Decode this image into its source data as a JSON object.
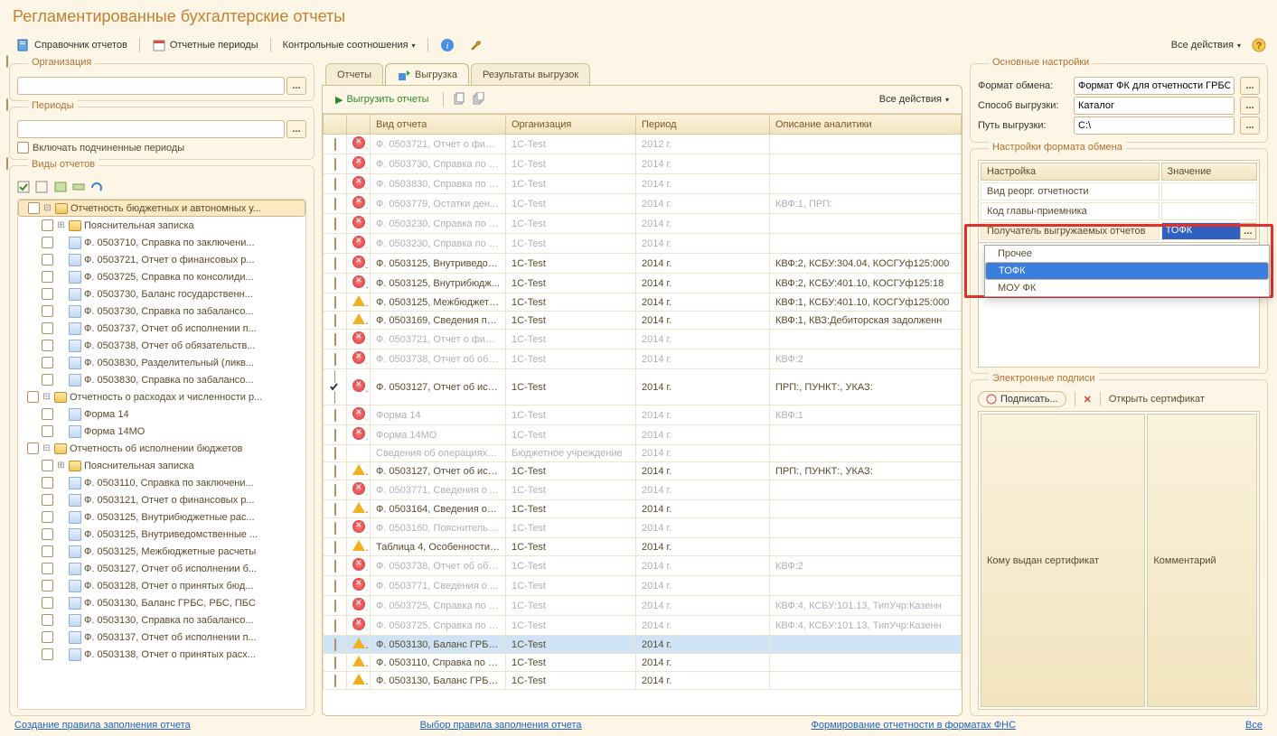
{
  "title": "Регламентированные бухгалтерские отчеты",
  "toolbar": {
    "ref_reports": "Справочник отчетов",
    "periods": "Отчетные периоды",
    "checks": "Контрольные соотношения",
    "all_actions": "Все действия"
  },
  "filters": {
    "org_legend": "Организация",
    "periods_legend": "Периоды",
    "include_sub": "Включать подчиненные периоды",
    "types_legend": "Виды отчетов"
  },
  "tree": [
    {
      "lvl": 0,
      "type": "folder",
      "exp": "minus",
      "sel": true,
      "label": "Отчетность бюджетных и автономных у..."
    },
    {
      "lvl": 1,
      "type": "folder",
      "exp": "plus",
      "label": "Пояснительная записка"
    },
    {
      "lvl": 1,
      "type": "doc",
      "label": "Ф. 0503710, Справка по заключени..."
    },
    {
      "lvl": 1,
      "type": "doc",
      "label": "Ф. 0503721, Отчет о финансовых р..."
    },
    {
      "lvl": 1,
      "type": "doc",
      "label": "Ф. 0503725, Справка по консолиди..."
    },
    {
      "lvl": 1,
      "type": "doc",
      "label": "Ф. 0503730, Баланс государственн..."
    },
    {
      "lvl": 1,
      "type": "doc",
      "label": "Ф. 0503730, Справка по забалансо..."
    },
    {
      "lvl": 1,
      "type": "doc",
      "label": "Ф. 0503737, Отчет об исполнении п..."
    },
    {
      "lvl": 1,
      "type": "doc",
      "label": "Ф. 0503738, Отчет об обязательств..."
    },
    {
      "lvl": 1,
      "type": "doc",
      "label": "Ф. 0503830, Разделительный (ликв..."
    },
    {
      "lvl": 1,
      "type": "doc",
      "label": "Ф. 0503830, Справка по забалансо..."
    },
    {
      "lvl": 0,
      "type": "folder",
      "exp": "minus",
      "label": "Отчетность о расходах и численности р..."
    },
    {
      "lvl": 1,
      "type": "doc",
      "label": "Форма 14"
    },
    {
      "lvl": 1,
      "type": "doc",
      "label": "Форма 14МО"
    },
    {
      "lvl": 0,
      "type": "folder",
      "exp": "minus",
      "label": "Отчетность об исполнении бюджетов"
    },
    {
      "lvl": 1,
      "type": "folder",
      "exp": "plus",
      "label": "Пояснительная записка"
    },
    {
      "lvl": 1,
      "type": "doc",
      "label": "Ф. 0503110, Справка по заключени..."
    },
    {
      "lvl": 1,
      "type": "doc",
      "label": "Ф. 0503121, Отчет о финансовых р..."
    },
    {
      "lvl": 1,
      "type": "doc",
      "label": "Ф. 0503125, Внутрибюджетные рас..."
    },
    {
      "lvl": 1,
      "type": "doc",
      "label": "Ф. 0503125, Внутриведомственные ..."
    },
    {
      "lvl": 1,
      "type": "doc",
      "label": "Ф. 0503125, Межбюджетные расчеты"
    },
    {
      "lvl": 1,
      "type": "doc",
      "label": "Ф. 0503127, Отчет об исполнении б..."
    },
    {
      "lvl": 1,
      "type": "doc",
      "label": "Ф. 0503128, Отчет о принятых бюд..."
    },
    {
      "lvl": 1,
      "type": "doc",
      "label": "Ф. 0503130, Баланс ГРБС, РБС, ПБС"
    },
    {
      "lvl": 1,
      "type": "doc",
      "label": "Ф. 0503130, Справка по забалансо..."
    },
    {
      "lvl": 1,
      "type": "doc",
      "label": "Ф. 0503137, Отчет об исполнении п..."
    },
    {
      "lvl": 1,
      "type": "doc",
      "label": "Ф. 0503138, Отчет о принятых расх..."
    }
  ],
  "tabs": {
    "reports": "Отчеты",
    "export": "Выгрузка",
    "results": "Результаты выгрузок"
  },
  "export_toolbar": {
    "export_reports": "Выгрузить отчеты",
    "all_actions": "Все действия"
  },
  "grid": {
    "headers": {
      "report": "Вид отчета",
      "org": "Организация",
      "period": "Период",
      "analytics": "Описание аналитики"
    },
    "rows": [
      {
        "dim": true,
        "st": "err",
        "rep": "Ф. 0503721, Отчет о фина...",
        "org": "1C-Test",
        "per": "2012 г.",
        "an": ""
      },
      {
        "dim": true,
        "st": "err",
        "rep": "Ф. 0503730, Справка по з...",
        "org": "1C-Test",
        "per": "2014 г.",
        "an": ""
      },
      {
        "dim": true,
        "st": "err",
        "rep": "Ф. 0503830, Справка по з...",
        "org": "1C-Test",
        "per": "2014 г.",
        "an": ""
      },
      {
        "dim": true,
        "st": "err",
        "rep": "Ф. 0503779, Остатки ден...",
        "org": "1C-Test",
        "per": "2014 г.",
        "an": "КВФ:1, ПРП:"
      },
      {
        "dim": true,
        "st": "err",
        "rep": "Ф. 0503230, Справка по з...",
        "org": "1C-Test",
        "per": "2014 г.",
        "an": ""
      },
      {
        "dim": true,
        "st": "err",
        "rep": "Ф. 0503230, Справка по з...",
        "org": "1C-Test",
        "per": "2014 г.",
        "an": ""
      },
      {
        "dim": false,
        "st": "err",
        "rep": "Ф. 0503125, Внутриведом...",
        "org": "1C-Test",
        "per": "2014 г.",
        "an": "КВФ:2, КСБУ:304.04, КОСГУф125:000"
      },
      {
        "dim": false,
        "st": "err",
        "rep": "Ф. 0503125, Внутрибюдж...",
        "org": "1C-Test",
        "per": "2014 г.",
        "an": "КВФ:2, КСБУ:401.10, КОСГУф125:18"
      },
      {
        "dim": false,
        "st": "warn",
        "rep": "Ф. 0503125, Межбюджетн...",
        "org": "1C-Test",
        "per": "2014 г.",
        "an": "КВФ:1, КСБУ:401.10, КОСГУф125:000"
      },
      {
        "dim": false,
        "st": "warn",
        "rep": "Ф. 0503169, Сведения по ...",
        "org": "1C-Test",
        "per": "2014 г.",
        "an": "КВФ:1, КВЗ:Дебиторская задолженн"
      },
      {
        "dim": true,
        "st": "err",
        "rep": "Ф. 0503721, Отчет о фина...",
        "org": "1C-Test",
        "per": "2014 г.",
        "an": ""
      },
      {
        "dim": true,
        "st": "err",
        "rep": "Ф. 0503738, Отчет об обя...",
        "org": "1C-Test",
        "per": "2014 г.",
        "an": "КВФ:2"
      },
      {
        "dim": false,
        "chk": true,
        "st": "err",
        "rep": "Ф. 0503127, Отчет об исп...",
        "org": "1C-Test",
        "per": "2014 г.",
        "an": "ПРП:, ПУНКТ:, УКАЗ:"
      },
      {
        "dim": true,
        "st": "err",
        "rep": "Форма 14",
        "org": "1C-Test",
        "per": "2014 г.",
        "an": "КВФ:1"
      },
      {
        "dim": true,
        "st": "err",
        "rep": "Форма 14МО",
        "org": "1C-Test",
        "per": "2014 г.",
        "an": ""
      },
      {
        "dim": true,
        "st": "",
        "rep": "Сведения об операциях с ...",
        "org": "Бюджетное учреждение",
        "per": "2014 г.",
        "an": ""
      },
      {
        "dim": false,
        "st": "warn",
        "rep": "Ф. 0503127, Отчет об исп...",
        "org": "1C-Test",
        "per": "2014 г.",
        "an": "ПРП:, ПУНКТ:, УКАЗ:"
      },
      {
        "dim": true,
        "st": "err",
        "rep": "Ф. 0503771, Сведения о ...",
        "org": "1C-Test",
        "per": "2014 г.",
        "an": ""
      },
      {
        "dim": false,
        "st": "warn",
        "rep": "Ф. 0503164, Сведения об ...",
        "org": "1C-Test",
        "per": "2014 г.",
        "an": ""
      },
      {
        "dim": true,
        "st": "err",
        "rep": "Ф. 0503160, Пояснительн...",
        "org": "1C-Test",
        "per": "2014 г.",
        "an": ""
      },
      {
        "dim": false,
        "st": "warn",
        "rep": "Таблица 4, Особенности ...",
        "org": "1C-Test",
        "per": "2014 г.",
        "an": ""
      },
      {
        "dim": true,
        "st": "err",
        "rep": "Ф. 0503738, Отчет об обя...",
        "org": "1C-Test",
        "per": "2014 г.",
        "an": "КВФ:2"
      },
      {
        "dim": true,
        "st": "err",
        "rep": "Ф. 0503771, Сведения о ...",
        "org": "1C-Test",
        "per": "2014 г.",
        "an": ""
      },
      {
        "dim": true,
        "st": "err",
        "rep": "Ф. 0503725, Справка по к...",
        "org": "1C-Test",
        "per": "2014 г.",
        "an": "КВФ:4, КСБУ:101.13, ТипУчр:Казенн"
      },
      {
        "dim": true,
        "st": "err",
        "rep": "Ф. 0503725, Справка по к...",
        "org": "1C-Test",
        "per": "2014 г.",
        "an": "КВФ:4, КСБУ:101.13, ТипУчр:Казенн"
      },
      {
        "dim": false,
        "sel": true,
        "st": "warn",
        "rep": "Ф. 0503130, Баланс ГРБС...",
        "org": "1C-Test",
        "per": "2014 г.",
        "an": ""
      },
      {
        "dim": false,
        "st": "warn",
        "rep": "Ф. 0503110, Справка по з...",
        "org": "1C-Test",
        "per": "2014 г.",
        "an": ""
      },
      {
        "dim": false,
        "st": "warn",
        "rep": "Ф. 0503130, Баланс ГРБС...",
        "org": "1C-Test",
        "per": "2014 г.",
        "an": ""
      }
    ]
  },
  "right": {
    "main_legend": "Основные настройки",
    "format_label": "Формат обмена:",
    "format_value": "Формат ФК для отчетности ГРБС",
    "method_label": "Способ выгрузки:",
    "method_value": "Каталог",
    "path_label": "Путь выгрузки:",
    "path_value": "C:\\",
    "fmt_legend": "Настройки формата обмена",
    "col_setting": "Настройка",
    "col_value": "Значение",
    "s1": "Вид реорг. отчетности",
    "s2": "Код главы-приемника",
    "s3": "Получатель выгружаемых отчетов",
    "s3v": "ТОФК",
    "dd": [
      "Прочее",
      "ТОФК",
      "МОУ ФК"
    ],
    "sign_legend": "Электронные подписи",
    "sign_btn": "Подписать...",
    "open_cert": "Открыть сертификат",
    "cert_col1": "Кому выдан сертификат",
    "cert_col2": "Комментарий"
  },
  "footer": {
    "l1": "Создание правила заполнения отчета",
    "l2": "Выбор правила заполнения отчета",
    "l3": "Формирование отчетности в форматах ФНС",
    "l4": "Все"
  }
}
